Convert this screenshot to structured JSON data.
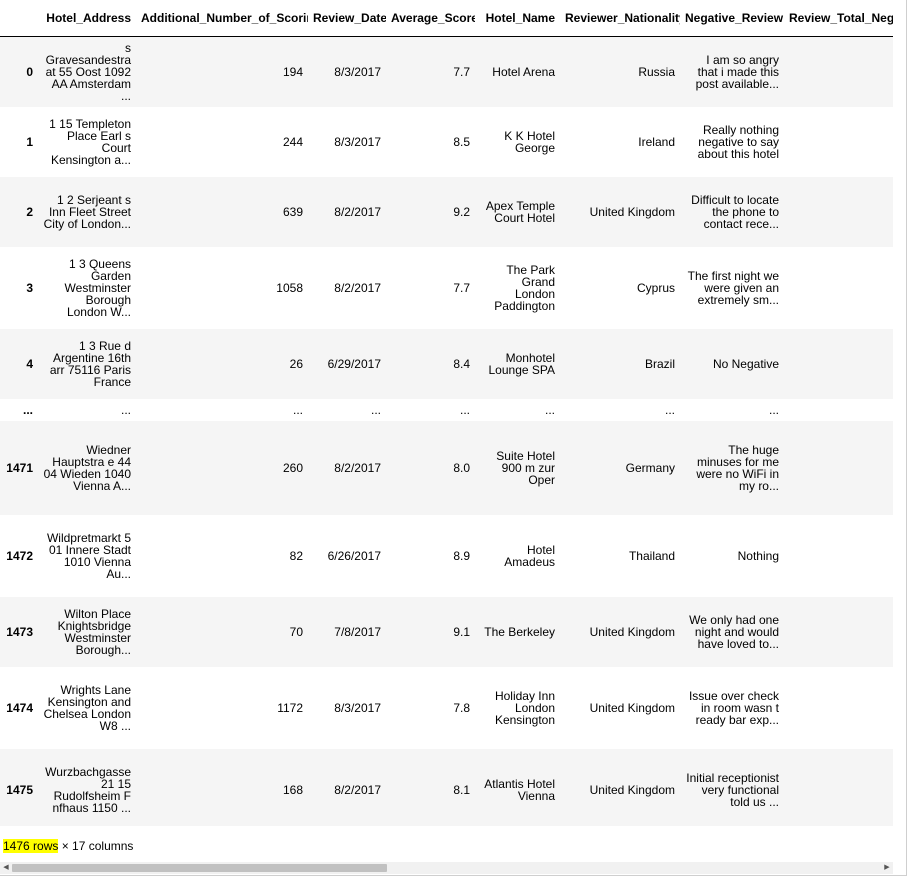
{
  "columns": [
    "",
    "Hotel_Address",
    "Additional_Number_of_Scoring",
    "Review_Date",
    "Average_Score",
    "Hotel_Name",
    "Reviewer_Nationality",
    "Negative_Review",
    "Review_Total_Negative"
  ],
  "rows": [
    {
      "idx": "0",
      "address": "s Gravesandestraat 55 Oost 1092 AA Amsterdam ...",
      "scoring": "194",
      "date": "8/3/2017",
      "avg": "7.7",
      "name": "Hotel Arena",
      "nat": "Russia",
      "neg": "I am so angry that i made this post available...",
      "h": 70
    },
    {
      "idx": "1",
      "address": "1 15 Templeton Place Earl s Court Kensington a...",
      "scoring": "244",
      "date": "8/3/2017",
      "avg": "8.5",
      "name": "K K Hotel George",
      "nat": "Ireland",
      "neg": "Really nothing negative to say about this hotel",
      "h": 70
    },
    {
      "idx": "2",
      "address": "1 2 Serjeant s Inn Fleet Street City of London...",
      "scoring": "639",
      "date": "8/2/2017",
      "avg": "9.2",
      "name": "Apex Temple Court Hotel",
      "nat": "United Kingdom",
      "neg": "Difficult to locate the phone to contact rece...",
      "h": 70
    },
    {
      "idx": "3",
      "address": "1 3 Queens Garden Westminster Borough London W...",
      "scoring": "1058",
      "date": "8/2/2017",
      "avg": "7.7",
      "name": "The Park Grand London Paddington",
      "nat": "Cyprus",
      "neg": "The first night we were given an extremely sm...",
      "h": 82
    },
    {
      "idx": "4",
      "address": "1 3 Rue d Argentine 16th arr 75116 Paris France",
      "scoring": "26",
      "date": "6/29/2017",
      "avg": "8.4",
      "name": "Monhotel Lounge SPA",
      "nat": "Brazil",
      "neg": "No Negative",
      "h": 70
    },
    {
      "idx": "...",
      "address": "...",
      "scoring": "...",
      "date": "...",
      "avg": "...",
      "name": "...",
      "nat": "...",
      "neg": "...",
      "h": 22
    },
    {
      "idx": "1471",
      "address": "Wiedner Hauptstra e 44 04 Wieden 1040 Vienna A...",
      "scoring": "260",
      "date": "8/2/2017",
      "avg": "8.0",
      "name": "Suite Hotel 900 m zur Oper",
      "nat": "Germany",
      "neg": "The huge minuses for me were no WiFi in my ro...",
      "h": 94
    },
    {
      "idx": "1472",
      "address": "Wildpretmarkt 5 01 Innere Stadt 1010 Vienna Au...",
      "scoring": "82",
      "date": "6/26/2017",
      "avg": "8.9",
      "name": "Hotel Amadeus",
      "nat": "Thailand",
      "neg": "Nothing",
      "h": 82
    },
    {
      "idx": "1473",
      "address": "Wilton Place Knightsbridge Westminster Borough...",
      "scoring": "70",
      "date": "7/8/2017",
      "avg": "9.1",
      "name": "The Berkeley",
      "nat": "United Kingdom",
      "neg": "We only had one night and would have loved to...",
      "h": 70
    },
    {
      "idx": "1474",
      "address": "Wrights Lane Kensington and Chelsea London W8 ...",
      "scoring": "1172",
      "date": "8/3/2017",
      "avg": "7.8",
      "name": "Holiday Inn London Kensington",
      "nat": "United Kingdom",
      "neg": "Issue over check in room wasn t ready bar exp...",
      "h": 82
    },
    {
      "idx": "1475",
      "address": "Wurzbachgasse 21 15 Rudolfsheim F nfhaus 1150 ...",
      "scoring": "168",
      "date": "8/2/2017",
      "avg": "8.1",
      "name": "Atlantis Hotel Vienna",
      "nat": "United Kingdom",
      "neg": "Initial receptionist very functional told us ...",
      "h": 82
    }
  ],
  "footer": {
    "rows_text": "1476 rows",
    "cols_text": " × 17 columns"
  },
  "colors": {
    "highlight": "#ffff00",
    "stripe": "#f5f5f5"
  },
  "icons": {
    "left": "scroll-left-arrow",
    "right": "scroll-right-arrow"
  }
}
